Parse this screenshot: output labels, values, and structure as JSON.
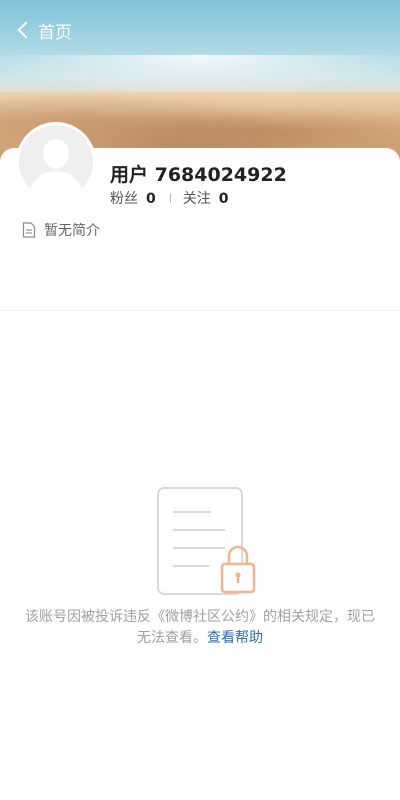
{
  "nav": {
    "back_label": "首页"
  },
  "profile": {
    "username": "用户 7684024922",
    "followers_label": "粉丝",
    "followers_count": "0",
    "following_label": "关注",
    "following_count": "0",
    "bio": "暂无简介"
  },
  "notice": {
    "message": "该账号因被投诉违反《微博社区公约》的相关规定，现已无法查看。",
    "help_link": "查看帮助"
  },
  "colors": {
    "link": "#2f6eaf",
    "lock_orange": "#f3b48a",
    "muted_text": "#a0a0a0"
  },
  "icons": [
    "chevron-left-icon",
    "avatar-placeholder-icon",
    "document-icon",
    "locked-document-icon"
  ]
}
